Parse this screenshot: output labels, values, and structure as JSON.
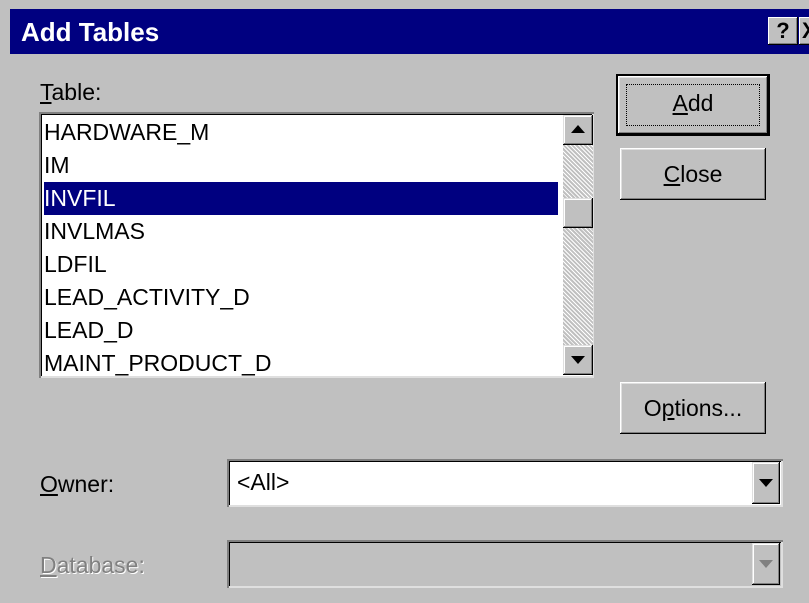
{
  "window": {
    "title": "Add Tables",
    "help_glyph": "?",
    "close_glyph": "X"
  },
  "table_label": {
    "accel": "T",
    "rest": "able:"
  },
  "table_list": {
    "items": [
      "HARDWARE_M",
      "IM",
      "INVFIL",
      "INVLMAS",
      "LDFIL",
      "LEAD_ACTIVITY_D",
      "LEAD_D",
      "MAINT_PRODUCT_D"
    ],
    "selected": "INVFIL"
  },
  "buttons": {
    "add": {
      "accel": "A",
      "rest": "dd"
    },
    "close": {
      "accel": "C",
      "rest": "lose"
    },
    "options": {
      "pre": "O",
      "accel": "p",
      "rest": "tions..."
    }
  },
  "owner": {
    "label_accel": "O",
    "label_rest": "wner:",
    "value": "<All>"
  },
  "database": {
    "label_accel": "D",
    "label_rest": "atabase:",
    "value": ""
  },
  "colors": {
    "titlebar": "#000080",
    "face": "#c0c0c0",
    "selection": "#000080"
  }
}
